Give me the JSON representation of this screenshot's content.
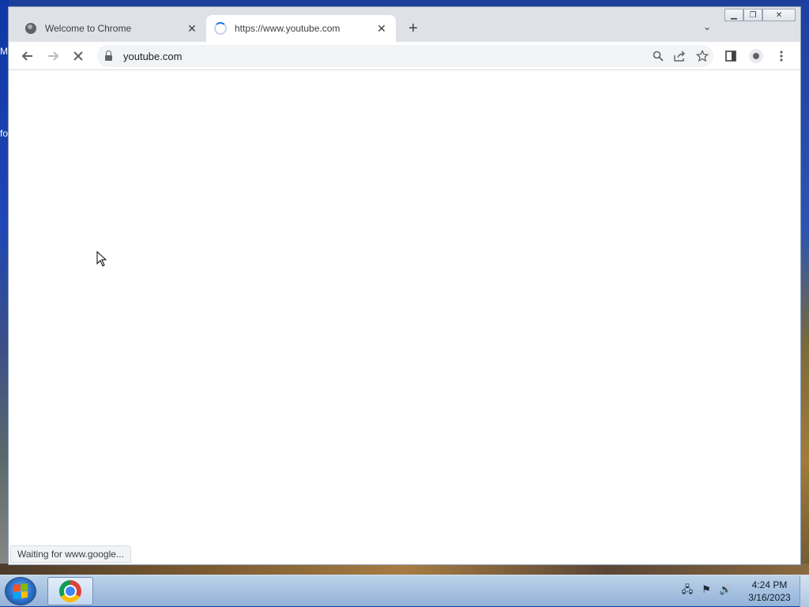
{
  "desktop": {
    "edge_text_top": "M",
    "edge_text_mid": "fo"
  },
  "browser": {
    "tabs": [
      {
        "title": "Welcome to Chrome",
        "favicon": "globe-icon",
        "active": false
      },
      {
        "title": "https://www.youtube.com",
        "favicon": "loading-spinner-icon",
        "active": true
      }
    ],
    "toolbar": {
      "back_icon": "back-arrow-icon",
      "forward_icon": "forward-arrow-icon",
      "stop_icon": "stop-icon",
      "url": "youtube.com"
    },
    "status_text": "Waiting for www.google..."
  },
  "taskbar": {
    "pinned": [
      {
        "name": "Google Chrome",
        "icon": "chrome-icon"
      }
    ],
    "time": "4:24 PM",
    "date": "3/16/2023"
  },
  "colors": {
    "chrome_tab_bg": "#dee1e6",
    "content_bg": "#ffffff",
    "taskbar_bg": "#a7c2e1"
  }
}
